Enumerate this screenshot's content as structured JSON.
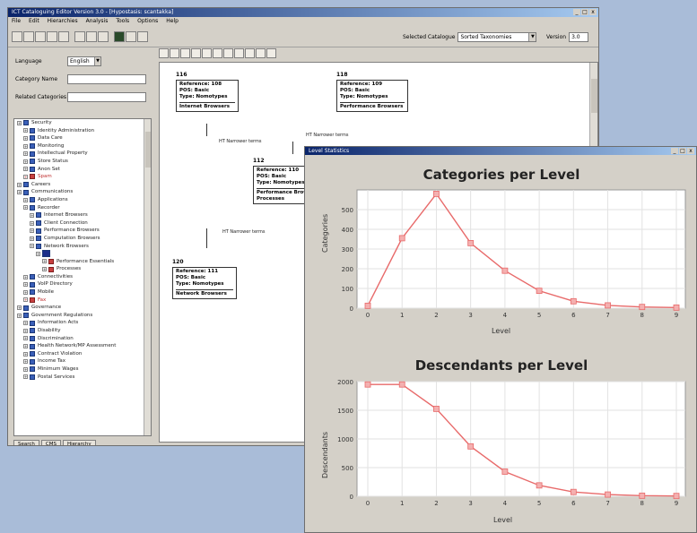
{
  "main_window": {
    "title": "ICT Cataloguing Editor Version 3.0 - [Hypostasis: scantakka]",
    "menu": [
      "File",
      "Edit",
      "Hierarchies",
      "Analysis",
      "Tools",
      "Options",
      "Help"
    ],
    "controls": [
      "_",
      "□",
      "x"
    ],
    "selected_catalogue_label": "Selected Catalogue",
    "selected_catalogue_value": "Sorted Taxonomies",
    "version_label": "Version",
    "version_value": "3.0",
    "form": {
      "language_label": "Language",
      "language_value": "English",
      "category_name_label": "Category Name",
      "related_categories_label": "Related Categories"
    },
    "tree_items": [
      {
        "label": "Security",
        "level": 0,
        "icon": "blue"
      },
      {
        "label": "Identity Administration",
        "level": 1,
        "icon": "blue"
      },
      {
        "label": "Data Care",
        "level": 1,
        "icon": "blue"
      },
      {
        "label": "Monitoring",
        "level": 1,
        "icon": "blue"
      },
      {
        "label": "Intellectual Property",
        "level": 1,
        "icon": "blue"
      },
      {
        "label": "Store Status",
        "level": 1,
        "icon": "blue"
      },
      {
        "label": "Anon Set",
        "level": 1,
        "icon": "blue"
      },
      {
        "label": "Spam",
        "level": 1,
        "icon": "red",
        "red": true
      },
      {
        "label": "Careers",
        "level": 0,
        "icon": "blue"
      },
      {
        "label": "Communications",
        "level": 0,
        "icon": "blue"
      },
      {
        "label": "Applications",
        "level": 1,
        "icon": "blue"
      },
      {
        "label": "Recorder",
        "level": 1,
        "icon": "blue"
      },
      {
        "label": "Internet Browsers",
        "level": 2,
        "icon": "blue"
      },
      {
        "label": "Client Connection",
        "level": 2,
        "icon": "blue"
      },
      {
        "label": "Performance Browsers",
        "level": 2,
        "icon": "blue"
      },
      {
        "label": "Computation Browsers",
        "level": 2,
        "icon": "blue"
      },
      {
        "label": "Network Browsers",
        "level": 2,
        "icon": "blue"
      },
      {
        "label": "",
        "level": 3,
        "icon": "selected"
      },
      {
        "label": "Performance Essentials",
        "level": 4,
        "icon": "red"
      },
      {
        "label": "Processes",
        "level": 4,
        "icon": "red"
      },
      {
        "label": "Connectivities",
        "level": 1,
        "icon": "blue"
      },
      {
        "label": "VoIP Directory",
        "level": 1,
        "icon": "blue"
      },
      {
        "label": "Mobile",
        "level": 1,
        "icon": "blue"
      },
      {
        "label": "Fax",
        "level": 1,
        "icon": "red",
        "red": true
      },
      {
        "label": "Governance",
        "level": 0,
        "icon": "blue"
      },
      {
        "label": "Government Regulations",
        "level": 0,
        "icon": "blue"
      },
      {
        "label": "Information Acts",
        "level": 1,
        "icon": "blue"
      },
      {
        "label": "Disability",
        "level": 1,
        "icon": "blue"
      },
      {
        "label": "Discrimination",
        "level": 1,
        "icon": "blue"
      },
      {
        "label": "Health Network/MP Assessment",
        "level": 1,
        "icon": "blue"
      },
      {
        "label": "Contract Violation",
        "level": 1,
        "icon": "blue"
      },
      {
        "label": "Income Tax",
        "level": 1,
        "icon": "blue"
      },
      {
        "label": "Minimum Wages",
        "level": 1,
        "icon": "blue"
      },
      {
        "label": "Postal Services",
        "level": 1,
        "icon": "blue"
      }
    ],
    "bottom_tabs": [
      "Search",
      "CMS",
      "Hierarchy"
    ],
    "diagram": {
      "nodes": [
        {
          "id": "116",
          "lines": [
            "Reference: 108",
            "POS: Basic",
            "Type: Nomotypes"
          ],
          "footer": "Internet Browsers"
        },
        {
          "id": "118",
          "lines": [
            "Reference: 109",
            "POS: Basic",
            "Type: Nomotypes"
          ],
          "footer": "Performance Browsers"
        },
        {
          "id": "112",
          "lines": [
            "Reference: 110",
            "POS: Basic",
            "Type: Nomotypes"
          ],
          "footer": "Performance Browsers",
          "extra": "Processes"
        },
        {
          "id": "120",
          "lines": [
            "Reference: 111",
            "POS: Basic",
            "Type: Nomotypes"
          ],
          "footer": "Network Browsers"
        }
      ],
      "edge_labels": [
        "HT Narrower terms",
        "HT Narrower terms",
        "HT Narrower terms",
        "HT Narrower terms"
      ]
    }
  },
  "chart_window": {
    "title": "Level Statistics",
    "controls": [
      "_",
      "□",
      "x"
    ]
  },
  "chart_data": [
    {
      "type": "line",
      "title": "Categories per Level",
      "xlabel": "Level",
      "ylabel": "Categories",
      "x": [
        0,
        1,
        2,
        3,
        4,
        5,
        6,
        7,
        8,
        9
      ],
      "series": [
        {
          "values": [
            12,
            355,
            580,
            330,
            190,
            88,
            35,
            14,
            6,
            3
          ]
        }
      ],
      "ylim": [
        0,
        600
      ],
      "yticks": [
        0,
        100,
        200,
        300,
        400,
        500
      ],
      "grid": true,
      "color": "#e86a6a"
    },
    {
      "type": "line",
      "title": "Descendants per Level",
      "xlabel": "Level",
      "ylabel": "Descendants",
      "x": [
        0,
        1,
        2,
        3,
        4,
        5,
        6,
        7,
        8,
        9
      ],
      "series": [
        {
          "values": [
            1950,
            1950,
            1525,
            870,
            430,
            190,
            75,
            30,
            10,
            5
          ]
        }
      ],
      "ylim": [
        0,
        2000
      ],
      "yticks": [
        0,
        500,
        1000,
        1500,
        2000
      ],
      "grid": true,
      "color": "#e86a6a"
    }
  ]
}
